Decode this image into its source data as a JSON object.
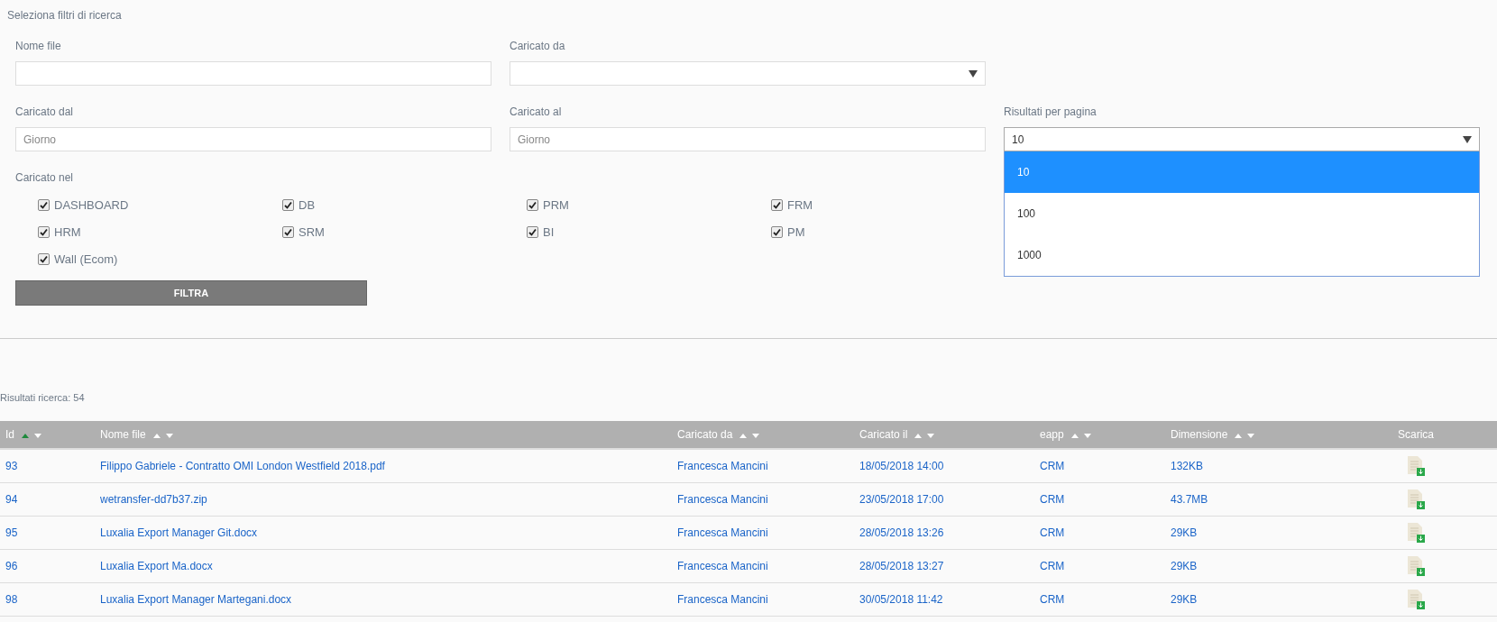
{
  "filters": {
    "title": "Seleziona filtri di ricerca",
    "fields": [
      {
        "kind": "text",
        "label": "Nome file"
      },
      {
        "kind": "select",
        "label": "Caricato da"
      },
      {
        "kind": "empty"
      },
      {
        "kind": "text",
        "label": "Caricato dal",
        "placeholder": "Giorno"
      },
      {
        "kind": "text",
        "label": "Caricato al",
        "placeholder": "Giorno"
      },
      {
        "kind": "select",
        "label": "Risultati per pagina",
        "value": "10",
        "expanded": true,
        "options": [
          {
            "label": "10",
            "selected": true
          },
          {
            "label": "100",
            "selected": false
          },
          {
            "label": "1000",
            "selected": false
          }
        ]
      }
    ],
    "modules_label": "Caricato nel",
    "modules": [
      {
        "label": "DASHBOARD",
        "checked": true
      },
      {
        "label": "DB",
        "checked": true
      },
      {
        "label": "PRM",
        "checked": true
      },
      {
        "label": "FRM",
        "checked": true
      },
      {
        "label": "HRM",
        "checked": true
      },
      {
        "label": "SRM",
        "checked": true
      },
      {
        "label": "BI",
        "checked": true
      },
      {
        "label": "PM",
        "checked": true
      },
      {
        "label": "Wall (Ecom)",
        "checked": true
      }
    ],
    "button": "FILTRA"
  },
  "results": {
    "count_text": "Risultati ricerca: 54",
    "columns": [
      {
        "kind": "sortable",
        "label": "Id",
        "sorted_ascending": true
      },
      {
        "kind": "sortable",
        "label": "Nome file",
        "sorted_ascending": false
      },
      {
        "kind": "sortable",
        "label": "Caricato da",
        "sorted_ascending": false
      },
      {
        "kind": "sortable",
        "label": "Caricato il",
        "sorted_ascending": false
      },
      {
        "kind": "sortable",
        "label": "eapp",
        "sorted_ascending": false
      },
      {
        "kind": "sortable",
        "label": "Dimensione",
        "sorted_ascending": false
      },
      {
        "kind": "plain",
        "label": "Scarica"
      }
    ],
    "rows": [
      [
        "93",
        "Filippo Gabriele - Contratto OMI London Westfield 2018.pdf",
        "Francesca Mancini",
        "18/05/2018 14:00",
        "CRM",
        "132KB"
      ],
      [
        "94",
        "wetransfer-dd7b37.zip",
        "Francesca Mancini",
        "23/05/2018 17:00",
        "CRM",
        "43.7MB"
      ],
      [
        "95",
        "Luxalia Export Manager Git.docx",
        "Francesca Mancini",
        "28/05/2018 13:26",
        "CRM",
        "29KB"
      ],
      [
        "96",
        "Luxalia Export Ma.docx",
        "Francesca Mancini",
        "28/05/2018 13:27",
        "CRM",
        "29KB"
      ],
      [
        "98",
        "Luxalia Export Manager Martegani.docx",
        "Francesca Mancini",
        "30/05/2018 11:42",
        "CRM",
        "29KB"
      ]
    ]
  }
}
